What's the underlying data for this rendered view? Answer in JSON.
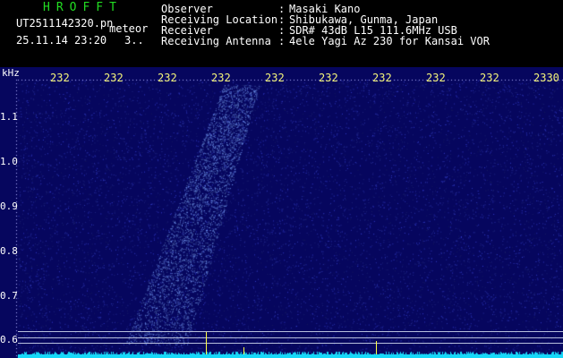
{
  "header": {
    "app_name": "HROFFT",
    "file_name": "UT2511142320.pn",
    "tag": "meteor",
    "datetime": "25.11.14 23:20",
    "count": "3.."
  },
  "info": [
    {
      "label": "Observer",
      "colon": ":",
      "value": "Masaki Kano"
    },
    {
      "label": "Receiving Location",
      "colon": ":",
      "value": "Shibukawa, Gunma, Japan"
    },
    {
      "label": "Receiver",
      "colon": ":",
      "value": "SDR# 43dB L15 111.6MHz USB"
    },
    {
      "label": "Receiving Antenna",
      "colon": ":",
      "value": "4ele Yagi Az 230 for Kansai VOR"
    }
  ],
  "plot": {
    "unit": "kHz",
    "y_ticks": [
      "1.1",
      "1.0",
      "0.9",
      "0.8",
      "0.7",
      "0.6"
    ],
    "x_ticks": [
      "232",
      "232",
      "232",
      "232",
      "232",
      "232",
      "232",
      "232",
      "232",
      "2330"
    ],
    "colors": {
      "background": "#06065e",
      "axis_text": "#ffffff",
      "time_tick_text": "#f4f47a",
      "signal": "#16d8f8",
      "marker": "#ffff44",
      "header_title": "#22dd22"
    }
  }
}
